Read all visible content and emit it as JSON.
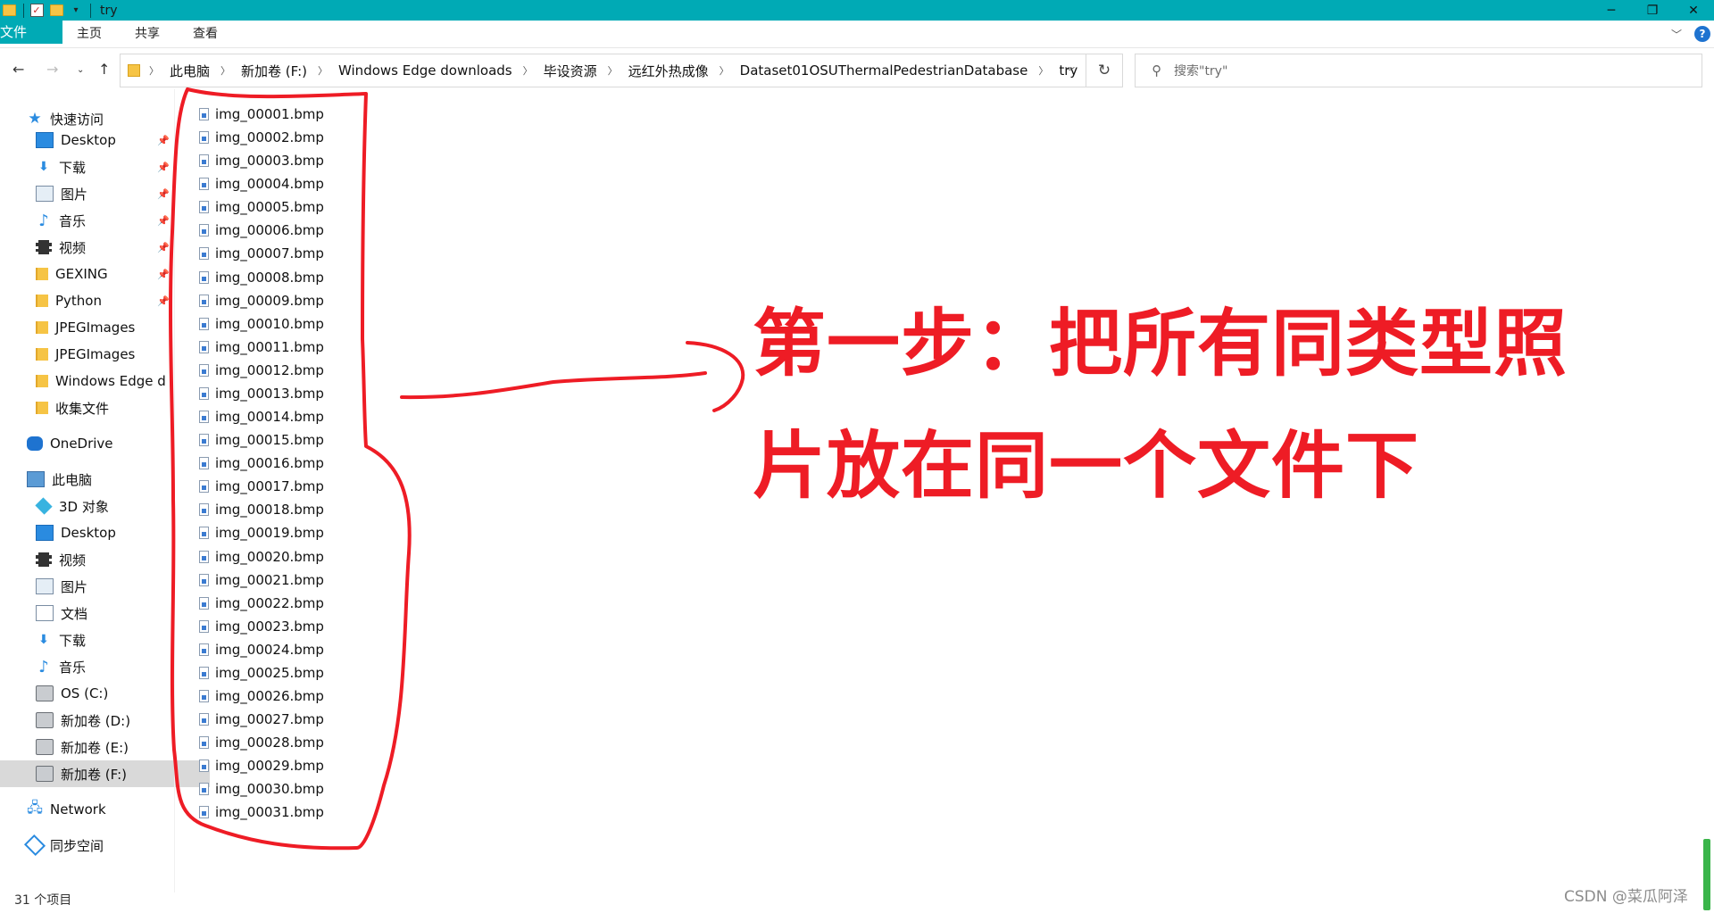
{
  "window": {
    "title": "try",
    "controls": {
      "minimize": "─",
      "maximize": "❐",
      "close": "✕"
    }
  },
  "ribbon": {
    "tabs": {
      "file": "文件",
      "home": "主页",
      "share": "共享",
      "view": "查看"
    },
    "help": "?"
  },
  "address": {
    "crumbs": [
      "此电脑",
      "新加卷 (F:)",
      "Windows Edge downloads",
      "毕设资源",
      "远红外热成像",
      "Dataset01OSUThermalPedestrianDatabase",
      "try"
    ],
    "search_placeholder": "搜索\"try\""
  },
  "sidebar": {
    "quick_access": "快速访问",
    "quick_items": [
      {
        "label": "Desktop",
        "icon": "desktop-icon",
        "pinned": true
      },
      {
        "label": "下载",
        "icon": "download-icon",
        "pinned": true
      },
      {
        "label": "图片",
        "icon": "pictures-icon",
        "pinned": true
      },
      {
        "label": "音乐",
        "icon": "music-icon",
        "pinned": true
      },
      {
        "label": "视频",
        "icon": "video-icon",
        "pinned": true
      },
      {
        "label": "GEXING",
        "icon": "folder-icon",
        "pinned": true
      },
      {
        "label": "Python",
        "icon": "folder-icon",
        "pinned": true
      },
      {
        "label": "JPEGImages",
        "icon": "folder-icon",
        "pinned": false
      },
      {
        "label": "JPEGImages",
        "icon": "folder-icon",
        "pinned": false
      },
      {
        "label": "Windows Edge d",
        "icon": "folder-icon",
        "pinned": false
      },
      {
        "label": "收集文件",
        "icon": "folder-icon",
        "pinned": false
      }
    ],
    "onedrive": "OneDrive",
    "this_pc": "此电脑",
    "pc_items": [
      {
        "label": "3D 对象",
        "icon": "3d-objects-icon"
      },
      {
        "label": "Desktop",
        "icon": "desktop-icon"
      },
      {
        "label": "视频",
        "icon": "video-icon"
      },
      {
        "label": "图片",
        "icon": "pictures-icon"
      },
      {
        "label": "文档",
        "icon": "documents-icon"
      },
      {
        "label": "下载",
        "icon": "download-icon"
      },
      {
        "label": "音乐",
        "icon": "music-icon"
      },
      {
        "label": "OS (C:)",
        "icon": "drive-icon"
      },
      {
        "label": "新加卷 (D:)",
        "icon": "drive-icon"
      },
      {
        "label": "新加卷 (E:)",
        "icon": "drive-icon"
      },
      {
        "label": "新加卷 (F:)",
        "icon": "drive-icon",
        "selected": true
      }
    ],
    "network": "Network",
    "sync": "同步空间"
  },
  "files": [
    "img_00001.bmp",
    "img_00002.bmp",
    "img_00003.bmp",
    "img_00004.bmp",
    "img_00005.bmp",
    "img_00006.bmp",
    "img_00007.bmp",
    "img_00008.bmp",
    "img_00009.bmp",
    "img_00010.bmp",
    "img_00011.bmp",
    "img_00012.bmp",
    "img_00013.bmp",
    "img_00014.bmp",
    "img_00015.bmp",
    "img_00016.bmp",
    "img_00017.bmp",
    "img_00018.bmp",
    "img_00019.bmp",
    "img_00020.bmp",
    "img_00021.bmp",
    "img_00022.bmp",
    "img_00023.bmp",
    "img_00024.bmp",
    "img_00025.bmp",
    "img_00026.bmp",
    "img_00027.bmp",
    "img_00028.bmp",
    "img_00029.bmp",
    "img_00030.bmp",
    "img_00031.bmp"
  ],
  "annotation": {
    "line1": "第一步：把所有同类型照",
    "line2": "片放在同一个文件下",
    "color": "#ee1c25"
  },
  "status": {
    "item_count": "31 个项目"
  },
  "watermark": "CSDN @菜瓜阿泽",
  "colors": {
    "accent": "#00aab5",
    "selection": "#d9d9d9"
  }
}
